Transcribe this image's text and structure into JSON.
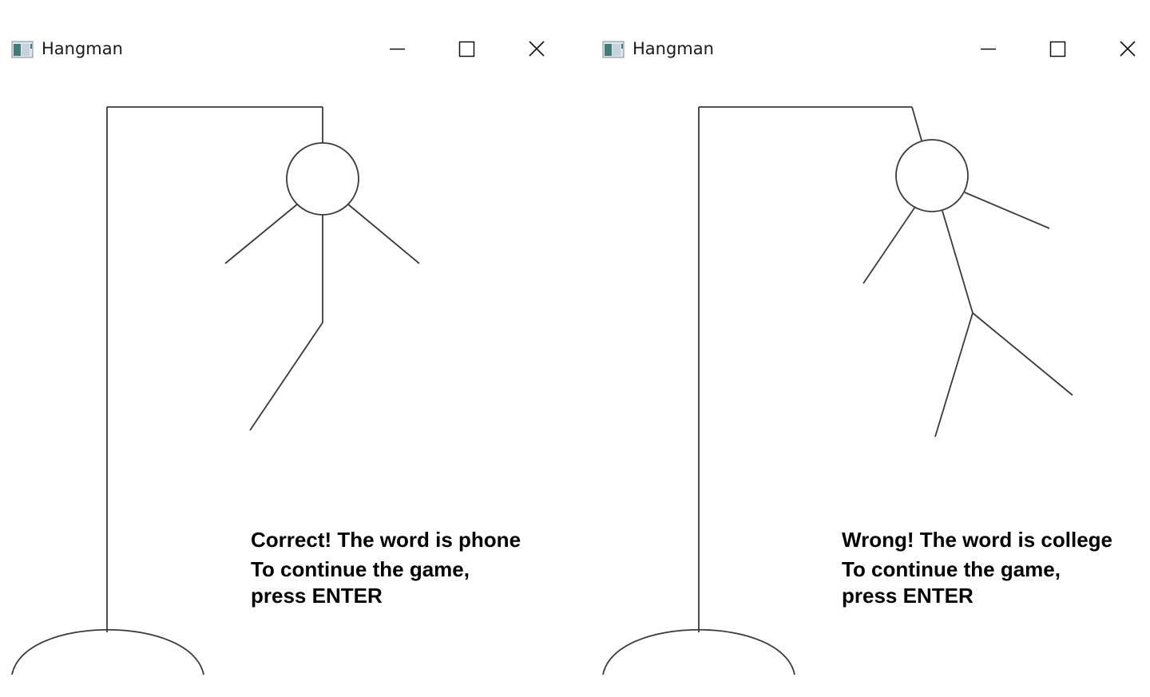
{
  "windows": [
    {
      "title": "Hangman",
      "result_message": "Correct! The word is phone",
      "continue_line1": "To continue the game,",
      "continue_line2": "press ENTER"
    },
    {
      "title": "Hangman",
      "result_message": "Wrong! The word is college",
      "continue_line1": "To continue the game,",
      "continue_line2": "press ENTER"
    }
  ],
  "colors": {
    "background": "#ffffff",
    "stroke": "#333333"
  },
  "icons": [
    "app-icon",
    "minimize-icon",
    "maximize-icon",
    "close-icon"
  ]
}
